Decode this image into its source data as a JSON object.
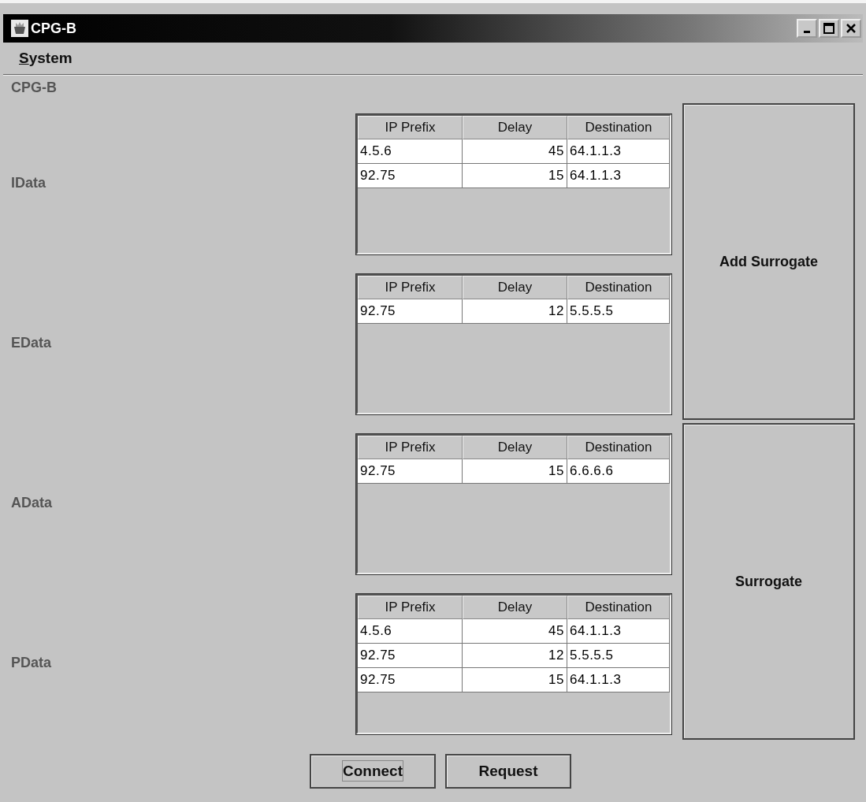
{
  "window": {
    "title": "CPG-B"
  },
  "menu": [
    {
      "label": "System"
    }
  ],
  "panel_title": "CPG-B",
  "sections": [
    {
      "label": "IData",
      "columns": [
        "IP Prefix",
        "Delay",
        "Destination"
      ],
      "rows": [
        [
          "4.5.6",
          "45",
          "64.1.1.3"
        ],
        [
          "92.75",
          "15",
          "64.1.1.3"
        ]
      ]
    },
    {
      "label": "EData",
      "columns": [
        "IP Prefix",
        "Delay",
        "Destination"
      ],
      "rows": [
        [
          "92.75",
          "12",
          "5.5.5.5"
        ]
      ]
    },
    {
      "label": "AData",
      "columns": [
        "IP Prefix",
        "Delay",
        "Destination"
      ],
      "rows": [
        [
          "92.75",
          "15",
          "6.6.6.6"
        ]
      ]
    },
    {
      "label": "PData",
      "columns": [
        "IP Prefix",
        "Delay",
        "Destination"
      ],
      "rows": [
        [
          "4.5.6",
          "45",
          "64.1.1.3"
        ],
        [
          "92.75",
          "12",
          "5.5.5.5"
        ],
        [
          "92.75",
          "15",
          "64.1.1.3"
        ]
      ]
    }
  ],
  "side_buttons": [
    "Add Surrogate",
    "Surrogate"
  ],
  "bottom_buttons": [
    {
      "label": "Connect",
      "focused": true
    },
    {
      "label": "Request",
      "focused": false
    }
  ]
}
